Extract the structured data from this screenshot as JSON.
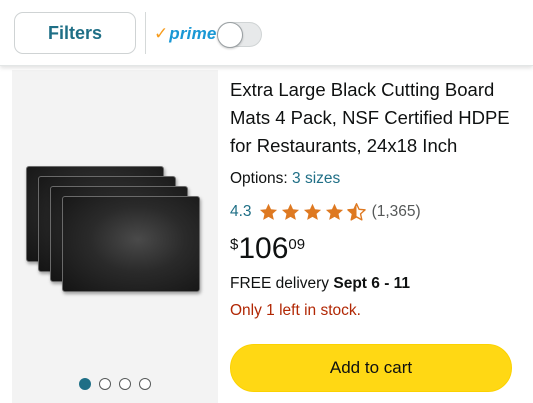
{
  "topbar": {
    "filters_label": "Filters",
    "prime_check": "✓",
    "prime_label": "prime",
    "prime_toggle_on": false
  },
  "gallery": {
    "image_count": 4,
    "active_index": 0
  },
  "product": {
    "title": "Extra Large Black Cutting Board Mats 4 Pack, NSF Certified HDPE for Restaurants, 24x18 Inch",
    "options_label": "Options:",
    "options_value": "3 sizes",
    "rating_value": "4.3",
    "rating_stars": 4.3,
    "rating_count": "(1,365)",
    "price_symbol": "$",
    "price_whole": "106",
    "price_fraction": "09",
    "delivery_prefix": "FREE delivery",
    "delivery_dates": "Sept 6 - 11",
    "stock_text": "Only 1 left in stock.",
    "cart_button": "Add to cart"
  },
  "colors": {
    "link": "#1f6f86",
    "star": "#de7921",
    "stock": "#b12704",
    "cart_button": "#ffd814"
  }
}
